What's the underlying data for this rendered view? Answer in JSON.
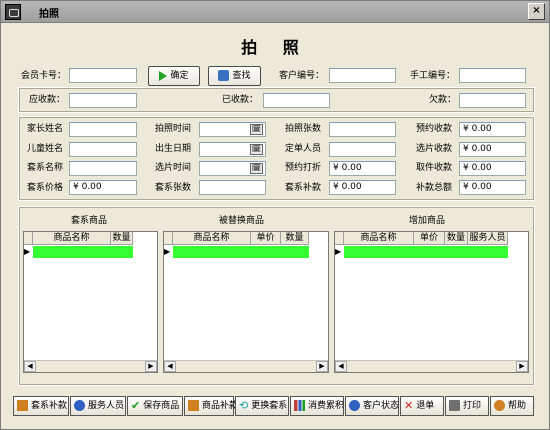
{
  "window": {
    "title": "拍照",
    "close_label": "×"
  },
  "heading": "拍  照",
  "top": {
    "member_card_label": "会员卡号：",
    "confirm_label": "确定",
    "search_label": "查找",
    "customer_no_label": "客户编号：",
    "manual_no_label": "手工编号："
  },
  "payment": {
    "due_label": "应收款：",
    "received_label": "已收款：",
    "owed_label": "欠款："
  },
  "details": {
    "parent_name_label": "家长姓名",
    "child_name_label": "儿童姓名",
    "package_name_label": "套系名称",
    "package_price_label": "套系价格",
    "package_price_value": "¥ 0.00",
    "photo_time_label": "拍照时间",
    "birth_date_label": "出生日期",
    "select_time_label": "选片时间",
    "package_count_label": "套系张数",
    "photo_count_label": "拍照张数",
    "order_staff_label": "定单人员",
    "booking_discount_label": "预约打折",
    "booking_discount_value": "¥ 0.00",
    "package_supplement_label": "套系补款",
    "package_supplement_value": "¥ 0.00",
    "booking_received_label": "预约收款",
    "booking_received_value": "¥ 0.00",
    "select_received_label": "选片收款",
    "select_received_value": "¥ 0.00",
    "pickup_received_label": "取件收款",
    "pickup_received_value": "¥ 0.00",
    "supplement_total_label": "补款总额",
    "supplement_total_value": "¥ 0.00",
    "date_picker_glyph": "🗓"
  },
  "grids": {
    "package_goods": {
      "title": "套系商品",
      "columns": [
        "商品名称",
        "数量"
      ]
    },
    "replaced_goods": {
      "title": "被替换商品",
      "columns": [
        "商品名称",
        "单价",
        "数量"
      ]
    },
    "added_goods": {
      "title": "增加商品",
      "columns": [
        "商品名称",
        "单价",
        "数量",
        "服务人员"
      ]
    },
    "row_marker": "▶",
    "scroll_left": "◀",
    "scroll_right": "▶"
  },
  "buttons": [
    {
      "label": "套系补款",
      "icon": "money-icon",
      "color": "#d08020"
    },
    {
      "label": "服务人员",
      "icon": "person-icon",
      "color": "#3060c0"
    },
    {
      "label": "保存商品",
      "icon": "check-icon",
      "color": "#20a020"
    },
    {
      "label": "商品补款",
      "icon": "money-icon",
      "color": "#d08020"
    },
    {
      "label": "更换套系",
      "icon": "swap-icon",
      "color": "#20a0a0"
    },
    {
      "label": "消费累积",
      "icon": "chart-icon",
      "color": "#c04040"
    },
    {
      "label": "客户状态",
      "icon": "person-icon",
      "color": "#3060c0"
    },
    {
      "label": "退单",
      "icon": "x-icon",
      "color": "#d02020"
    },
    {
      "label": "打印",
      "icon": "printer-icon",
      "color": "#505050"
    },
    {
      "label": "帮助",
      "icon": "help-icon",
      "color": "#d08020"
    }
  ]
}
